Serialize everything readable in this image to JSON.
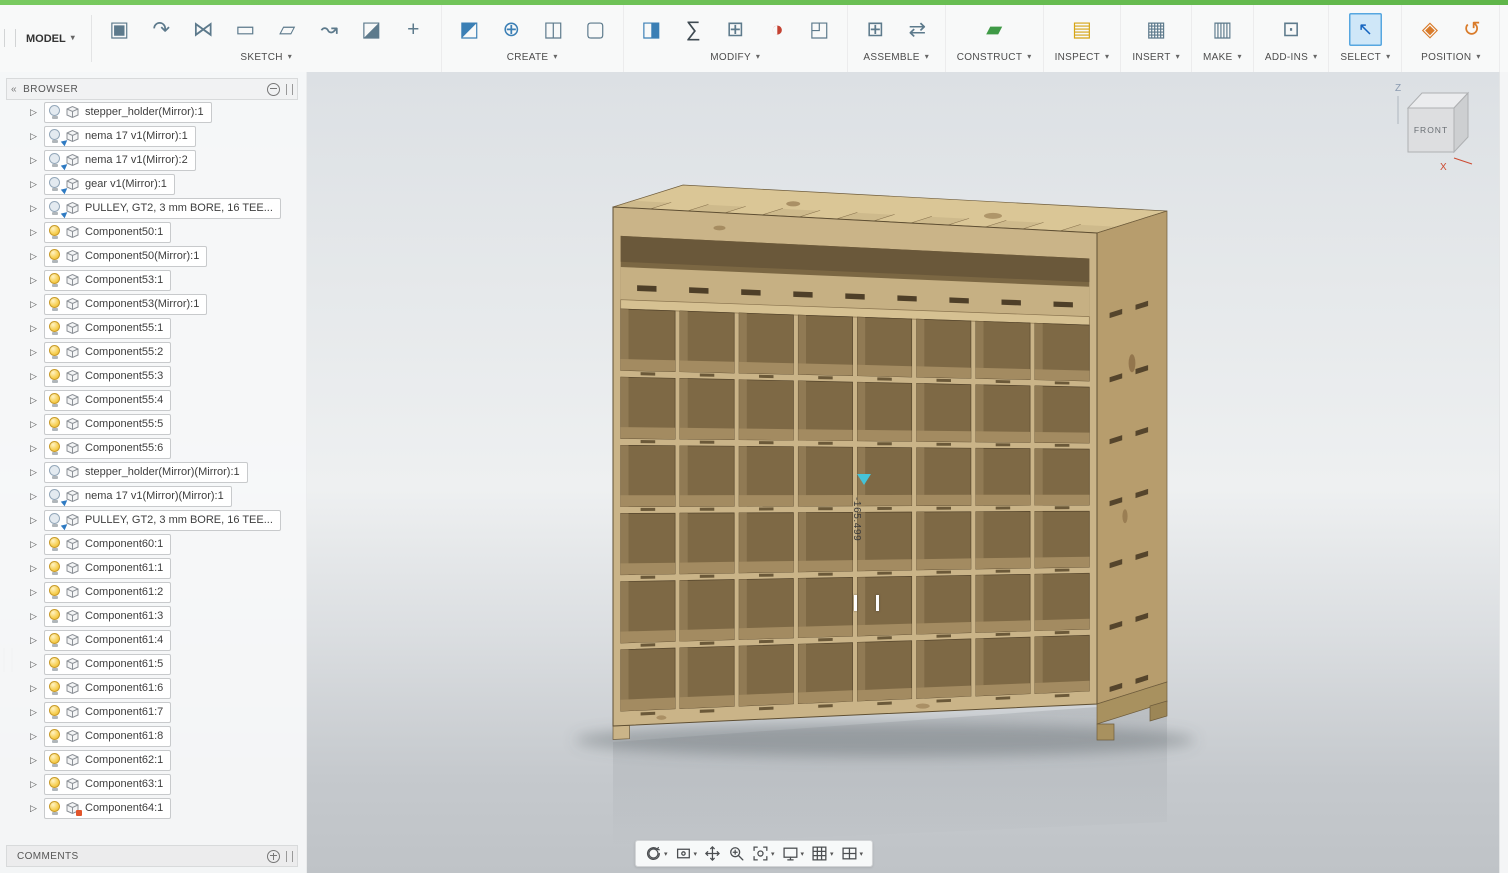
{
  "toolbar": {
    "workspace": {
      "label": "MODEL"
    },
    "groups": [
      {
        "label": "SKETCH",
        "icons": [
          {
            "name": "create-sketch-icon",
            "glyph": "▣"
          },
          {
            "name": "arc-icon",
            "glyph": "↷"
          },
          {
            "name": "mirror-icon",
            "glyph": "⋈"
          },
          {
            "name": "rectangle-icon",
            "glyph": "▭"
          },
          {
            "name": "offset-icon",
            "glyph": "▱"
          },
          {
            "name": "spline-icon",
            "glyph": "↝"
          },
          {
            "name": "project-icon",
            "glyph": "◪"
          },
          {
            "name": "sketch-point-icon",
            "glyph": "+"
          }
        ]
      },
      {
        "label": "CREATE",
        "icons": [
          {
            "name": "new-body-icon",
            "glyph": "◩",
            "cls": "c-blue"
          },
          {
            "name": "pattern-icon",
            "glyph": "⊕",
            "cls": "c-blue"
          },
          {
            "name": "mirror-bodies-icon",
            "glyph": "◫"
          },
          {
            "name": "pipe-icon",
            "glyph": "▢"
          }
        ]
      },
      {
        "label": "MODIFY",
        "icons": [
          {
            "name": "press-pull-icon",
            "glyph": "◨",
            "cls": "c-blue"
          },
          {
            "name": "parameters-icon",
            "glyph": "∑",
            "cls": "c-dark"
          },
          {
            "name": "combine-icon",
            "glyph": "⊞"
          },
          {
            "name": "section-analysis-icon",
            "glyph": "◑",
            "cls": "c-red"
          },
          {
            "name": "split-body-icon",
            "glyph": "◰"
          }
        ]
      },
      {
        "label": "ASSEMBLE",
        "icons": [
          {
            "name": "new-component-icon",
            "glyph": "⊞"
          },
          {
            "name": "joint-icon",
            "glyph": "⇄"
          }
        ]
      },
      {
        "label": "CONSTRUCT",
        "icons": [
          {
            "name": "construction-plane-icon",
            "glyph": "▰",
            "cls": "c-green"
          }
        ]
      },
      {
        "label": "INSPECT",
        "icons": [
          {
            "name": "measure-icon",
            "glyph": "▤",
            "cls": "c-yellow"
          }
        ]
      },
      {
        "label": "INSERT",
        "icons": [
          {
            "name": "insert-icon",
            "glyph": "▦"
          }
        ]
      },
      {
        "label": "MAKE",
        "icons": [
          {
            "name": "make-icon",
            "glyph": "▥"
          }
        ]
      },
      {
        "label": "ADD-INS",
        "icons": [
          {
            "name": "add-ins-icon",
            "glyph": "⊡"
          }
        ]
      },
      {
        "label": "SELECT",
        "icons": [
          {
            "name": "select-icon",
            "glyph": "↖",
            "cls": "c-sel",
            "tile": "sel"
          }
        ]
      },
      {
        "label": "POSITION",
        "icons": [
          {
            "name": "capture-position-icon",
            "glyph": "◈",
            "cls": "c-orange"
          },
          {
            "name": "revert-position-icon",
            "glyph": "↺",
            "cls": "c-orange"
          }
        ]
      }
    ]
  },
  "browser": {
    "title": "BROWSER",
    "items": [
      {
        "label": "stepper_holder(Mirror):1",
        "bulb": "off",
        "mark": ""
      },
      {
        "label": "nema 17 v1(Mirror):1",
        "bulb": "off",
        "mark": "linked"
      },
      {
        "label": "nema 17 v1(Mirror):2",
        "bulb": "off",
        "mark": "linked"
      },
      {
        "label": "gear v1(Mirror):1",
        "bulb": "off",
        "mark": "linked"
      },
      {
        "label": "PULLEY, GT2, 3 mm BORE,  16 TEE...",
        "bulb": "off",
        "mark": "linked"
      },
      {
        "label": "Component50:1",
        "bulb": "on",
        "mark": ""
      },
      {
        "label": "Component50(Mirror):1",
        "bulb": "on",
        "mark": ""
      },
      {
        "label": "Component53:1",
        "bulb": "on",
        "mark": ""
      },
      {
        "label": "Component53(Mirror):1",
        "bulb": "on",
        "mark": ""
      },
      {
        "label": "Component55:1",
        "bulb": "on",
        "mark": ""
      },
      {
        "label": "Component55:2",
        "bulb": "on",
        "mark": ""
      },
      {
        "label": "Component55:3",
        "bulb": "on",
        "mark": ""
      },
      {
        "label": "Component55:4",
        "bulb": "on",
        "mark": ""
      },
      {
        "label": "Component55:5",
        "bulb": "on",
        "mark": ""
      },
      {
        "label": "Component55:6",
        "bulb": "on",
        "mark": ""
      },
      {
        "label": "stepper_holder(Mirror)(Mirror):1",
        "bulb": "off",
        "mark": ""
      },
      {
        "label": "nema 17 v1(Mirror)(Mirror):1",
        "bulb": "off",
        "mark": "linked"
      },
      {
        "label": "PULLEY, GT2, 3 mm BORE,  16 TEE...",
        "bulb": "off",
        "mark": "linked"
      },
      {
        "label": "Component60:1",
        "bulb": "on",
        "mark": ""
      },
      {
        "label": "Component61:1",
        "bulb": "on",
        "mark": ""
      },
      {
        "label": "Component61:2",
        "bulb": "on",
        "mark": ""
      },
      {
        "label": "Component61:3",
        "bulb": "on",
        "mark": ""
      },
      {
        "label": "Component61:4",
        "bulb": "on",
        "mark": ""
      },
      {
        "label": "Component61:5",
        "bulb": "on",
        "mark": ""
      },
      {
        "label": "Component61:6",
        "bulb": "on",
        "mark": ""
      },
      {
        "label": "Component61:7",
        "bulb": "on",
        "mark": ""
      },
      {
        "label": "Component61:8",
        "bulb": "on",
        "mark": ""
      },
      {
        "label": "Component62:1",
        "bulb": "on",
        "mark": ""
      },
      {
        "label": "Component63:1",
        "bulb": "on",
        "mark": ""
      },
      {
        "label": "Component64:1",
        "bulb": "on",
        "mark": "modified"
      }
    ]
  },
  "comments": {
    "title": "COMMENTS"
  },
  "viewport": {
    "viewcube": {
      "front_label": "FRONT",
      "axis_z_label": "Z",
      "axis_x_label": "X"
    },
    "annotation": {
      "value": "-165.499"
    },
    "model": {
      "description": "laser-cut plywood pigeonhole shelf",
      "columns": 8,
      "rows": 6,
      "wood_color": "#cab488",
      "interior_color": "#7e6945"
    },
    "navbar": {
      "items": [
        {
          "name": "orbit-icon",
          "caret": true
        },
        {
          "name": "look-at-icon",
          "caret": true
        },
        {
          "name": "pan-icon",
          "caret": false
        },
        {
          "name": "zoom-icon",
          "caret": false
        },
        {
          "name": "fit-icon",
          "caret": true
        },
        {
          "name": "display-settings-icon",
          "caret": true
        },
        {
          "name": "grid-snaps-icon",
          "caret": true
        },
        {
          "name": "viewports-icon",
          "caret": true
        }
      ]
    }
  }
}
